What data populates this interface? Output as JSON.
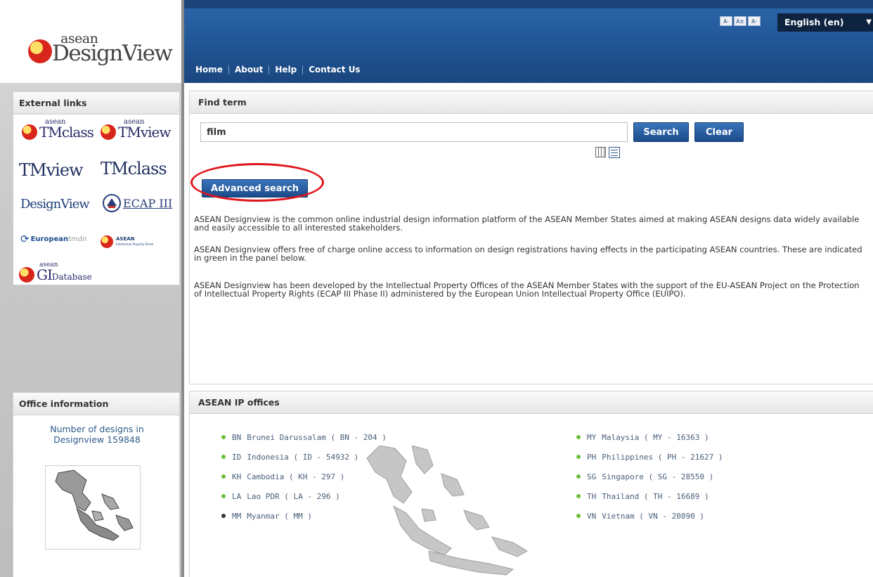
{
  "brand": {
    "small": "asean",
    "big": "DesignView"
  },
  "header": {
    "font_buttons": [
      "A-",
      "A±",
      "A-"
    ],
    "language": "English (en)",
    "nav": [
      "Home",
      "About",
      "Help",
      "Contact Us"
    ]
  },
  "external_links": {
    "title": "External links",
    "items": [
      {
        "small": "asean",
        "label": "TMclass"
      },
      {
        "small": "asean",
        "label": "TMview"
      },
      {
        "label": "TMview"
      },
      {
        "label": "TMclass"
      },
      {
        "label": "DesignView"
      },
      {
        "label": "ECAP III"
      },
      {
        "label": "European",
        "suffix": "tmdn"
      },
      {
        "label": "ASEAN",
        "sub": "Intellectual Property Portal"
      },
      {
        "small": "asean",
        "label": "GI",
        "suffix": "Database"
      }
    ]
  },
  "office_info": {
    "title": "Office information",
    "count_line1": "Number of designs in",
    "count_line2": "Designview 159848"
  },
  "find_term": {
    "title": "Find term",
    "query": "film",
    "search_label": "Search",
    "clear_label": "Clear",
    "advanced_label": "Advanced search",
    "paragraphs": [
      "ASEAN Designview is the common online industrial design information platform of the ASEAN Member States aimed at making ASEAN designs data widely available and easily accessible to all interested stakeholders.",
      "ASEAN Designview offers free of charge online access to information on design registrations having effects in the participating ASEAN countries. These are indicated in green in the panel below.",
      "ASEAN Designview has been developed by the Intellectual Property Offices of the ASEAN Member States with the support of the EU-ASEAN Project on the Protection of Intellectual Property Rights (ECAP III Phase II) administered by the European Union Intellectual Property Office (EUIPO)."
    ]
  },
  "ip_offices": {
    "title": "ASEAN IP offices",
    "left": [
      {
        "code": "BN",
        "label": "Brunei Darussalam ( BN - 204 )",
        "status_color": "#6bbf3a"
      },
      {
        "code": "ID",
        "label": "Indonesia ( ID - 54932 )",
        "status_color": "#6bbf3a"
      },
      {
        "code": "KH",
        "label": "Cambodia ( KH - 297 )",
        "status_color": "#6bbf3a"
      },
      {
        "code": "LA",
        "label": "Lao PDR ( LA - 296 )",
        "status_color": "#6bbf3a"
      },
      {
        "code": "MM",
        "label": "Myanmar ( MM )",
        "status_color": "#333333"
      }
    ],
    "right": [
      {
        "code": "MY",
        "label": "Malaysia ( MY - 16363 )",
        "status_color": "#6bbf3a"
      },
      {
        "code": "PH",
        "label": "Philippines ( PH - 21627 )",
        "status_color": "#6bbf3a"
      },
      {
        "code": "SG",
        "label": "Singapore ( SG - 28550 )",
        "status_color": "#6bbf3a"
      },
      {
        "code": "TH",
        "label": "Thailand ( TH - 16689 )",
        "status_color": "#6bbf3a"
      },
      {
        "code": "VN",
        "label": "Vietnam ( VN - 20890 )",
        "status_color": "#6bbf3a"
      }
    ]
  },
  "colors": {
    "header_blue": "#1d4e8b",
    "button_blue": "#1b4a8a",
    "highlight_red": "#e0141b",
    "available_green": "#6bbf3a"
  }
}
